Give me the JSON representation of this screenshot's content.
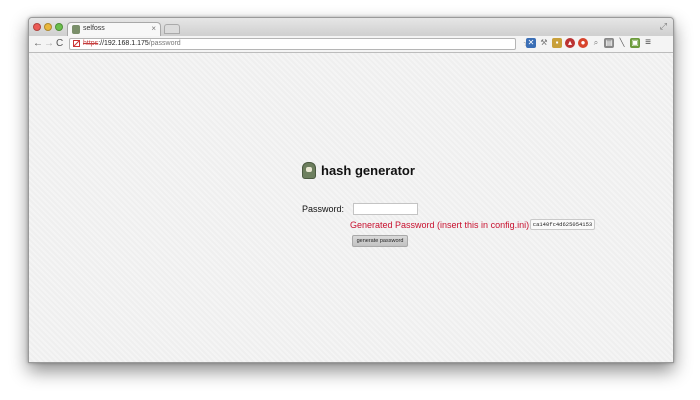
{
  "browser": {
    "tab_title": "selfoss",
    "tab_close": "×",
    "url_scheme": "https",
    "url_rest": "://192.168.1.175",
    "url_path": "/password"
  },
  "page": {
    "title": "hash generator",
    "password_label": "Password:",
    "password_value": "",
    "generated_label": "Generated Password (insert this in config.ini):",
    "generated_hash": "ca140fc4d625054153",
    "button_label": "generate password"
  },
  "colors": {
    "error_red": "#c8102e"
  }
}
